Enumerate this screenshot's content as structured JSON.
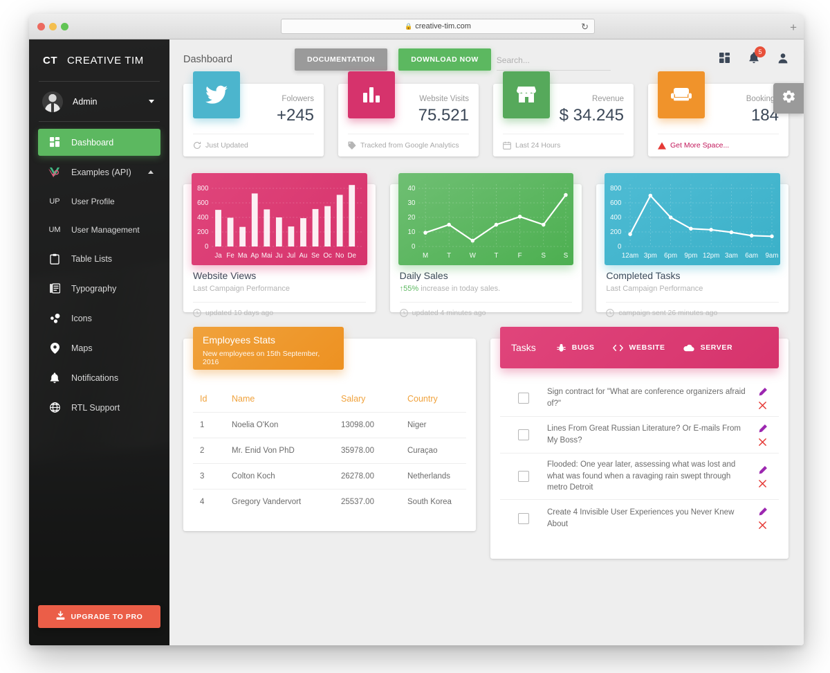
{
  "browser": {
    "url": "creative-tim.com",
    "lock_icon": "lock-icon",
    "reload_icon": "reload-icon",
    "new_tab_icon": "plus-icon"
  },
  "sidebar": {
    "brand_mark": "CT",
    "brand_name": "CREATIVE TIM",
    "user": {
      "name": "Admin",
      "avatar": "user-avatar"
    },
    "items": [
      {
        "label": "Dashboard",
        "icon": "dashboard-icon",
        "active": true
      },
      {
        "label": "Examples (API)",
        "icon": "vue-icon",
        "expanded": true
      },
      {
        "label": "User Profile",
        "abbr": "UP"
      },
      {
        "label": "User Management",
        "abbr": "UM"
      },
      {
        "label": "Table Lists",
        "icon": "clipboard-icon"
      },
      {
        "label": "Typography",
        "icon": "typography-icon"
      },
      {
        "label": "Icons",
        "icon": "bubbles-icon"
      },
      {
        "label": "Maps",
        "icon": "map-pin-icon"
      },
      {
        "label": "Notifications",
        "icon": "bell-icon"
      },
      {
        "label": "RTL Support",
        "icon": "globe-icon"
      }
    ],
    "upgrade_label": "UPGRADE TO PRO",
    "upgrade_icon": "download-icon"
  },
  "header": {
    "title": "Dashboard",
    "documentation_label": "DOCUMENTATION",
    "download_label": "DOWNLOAD NOW",
    "search_placeholder": "Search...",
    "search_value": "",
    "icons": {
      "dashboard_grid": "grid-icon",
      "notifications": "bell-icon",
      "notification_count": "5",
      "person": "person-icon",
      "settings": "gear-icon"
    }
  },
  "stats": [
    {
      "icon": "twitter-icon",
      "color": "#4cb5cd",
      "label": "Folowers",
      "value": "+245",
      "foot": "Just Updated",
      "foot_icon": "refresh-icon",
      "warn": false
    },
    {
      "icon": "bar-chart-icon",
      "color": "#d6336c",
      "label": "Website Visits",
      "value": "75.521",
      "foot": "Tracked from Google Analytics",
      "foot_icon": "tag-icon",
      "warn": false
    },
    {
      "icon": "store-icon",
      "color": "#56a95b",
      "label": "Revenue",
      "value": "$ 34.245",
      "foot": "Last 24 Hours",
      "foot_icon": "calendar-icon",
      "warn": false
    },
    {
      "icon": "sofa-icon",
      "color": "#f0932b",
      "label": "Bookings",
      "value": "184",
      "foot": "Get More Space...",
      "foot_icon": "warning-icon",
      "warn": true
    }
  ],
  "charts": [
    {
      "title": "Website Views",
      "subtitle": "Last Campaign Performance",
      "footer": "updated 10 days ago",
      "footer_icon": "clock-icon",
      "theme": "pink"
    },
    {
      "title": "Daily Sales",
      "subtitle_prefix": "55%",
      "subtitle": " increase in today sales.",
      "footer": "updated 4 minutes ago",
      "footer_icon": "clock-icon",
      "theme": "green"
    },
    {
      "title": "Completed Tasks",
      "subtitle": "Last Campaign Performance",
      "footer": "campaign sent 26 minutes ago",
      "footer_icon": "clock-icon",
      "theme": "blue"
    }
  ],
  "chart_data": [
    {
      "type": "bar",
      "title": "Website Views",
      "categories": [
        "Ja",
        "Fe",
        "Ma",
        "Ap",
        "Mai",
        "Ju",
        "Jul",
        "Au",
        "Se",
        "Oc",
        "No",
        "De"
      ],
      "values": [
        490,
        395,
        270,
        730,
        505,
        400,
        275,
        390,
        515,
        555,
        710,
        845
      ],
      "ytick_labels": [
        "0",
        "200",
        "400",
        "600",
        "800"
      ],
      "yticks": [
        0,
        200,
        400,
        600,
        800
      ],
      "ylim": [
        0,
        900
      ],
      "xlabel": "",
      "ylabel": "",
      "grid": true,
      "legend": "none",
      "series_color": "#ffffff",
      "background": "#d6336c"
    },
    {
      "type": "line",
      "title": "Daily Sales",
      "categories": [
        "M",
        "T",
        "W",
        "T",
        "F",
        "S",
        "S"
      ],
      "values": [
        9,
        14.5,
        4,
        14.5,
        20.5,
        15,
        36
      ],
      "ytick_labels": [
        "0",
        "10",
        "20",
        "30",
        "40"
      ],
      "yticks": [
        0,
        10,
        20,
        30,
        40
      ],
      "ylim": [
        0,
        42
      ],
      "xlabel": "",
      "ylabel": "",
      "grid": true,
      "legend": "none",
      "series_color": "#ffffff",
      "background": "#4caf50"
    },
    {
      "type": "line",
      "title": "Completed Tasks",
      "categories": [
        "12am",
        "3pm",
        "6pm",
        "9pm",
        "12pm",
        "3am",
        "6am",
        "9am"
      ],
      "values": [
        170,
        700,
        400,
        245,
        230,
        195,
        150,
        140
      ],
      "ytick_labels": [
        "0",
        "200",
        "400",
        "600",
        "800"
      ],
      "yticks": [
        0,
        200,
        400,
        600,
        800
      ],
      "ylim": [
        0,
        900
      ],
      "xlabel": "",
      "ylabel": "",
      "grid": true,
      "legend": "none",
      "series_color": "#ffffff",
      "background": "#3ab0c8"
    }
  ],
  "employees": {
    "title": "Employees Stats",
    "subtitle": "New employees on 15th September, 2016",
    "columns": [
      "Id",
      "Name",
      "Salary",
      "Country"
    ],
    "rows": [
      {
        "id": "1",
        "name": "Noelia O'Kon",
        "salary": "13098.00",
        "country": "Niger"
      },
      {
        "id": "2",
        "name": "Mr. Enid Von PhD",
        "salary": "35978.00",
        "country": "Curaçao"
      },
      {
        "id": "3",
        "name": "Colton Koch",
        "salary": "26278.00",
        "country": "Netherlands"
      },
      {
        "id": "4",
        "name": "Gregory Vandervort",
        "salary": "25537.00",
        "country": "South Korea"
      }
    ]
  },
  "tasks": {
    "title": "Tasks",
    "tabs": [
      {
        "label": "BUGS",
        "icon": "bug-icon"
      },
      {
        "label": "WEBSITE",
        "icon": "code-icon"
      },
      {
        "label": "SERVER",
        "icon": "cloud-icon"
      }
    ],
    "items": [
      {
        "text": "Sign contract for \"What are conference organizers afraid of?\"",
        "checked": false
      },
      {
        "text": "Lines From Great Russian Literature? Or E-mails From My Boss?",
        "checked": false
      },
      {
        "text": "Flooded: One year later, assessing what was lost and what was found when a ravaging rain swept through metro Detroit",
        "checked": false
      },
      {
        "text": "Create 4 Invisible User Experiences you Never Knew About",
        "checked": false
      }
    ],
    "edit_icon": "pencil-icon",
    "delete_icon": "close-icon"
  }
}
